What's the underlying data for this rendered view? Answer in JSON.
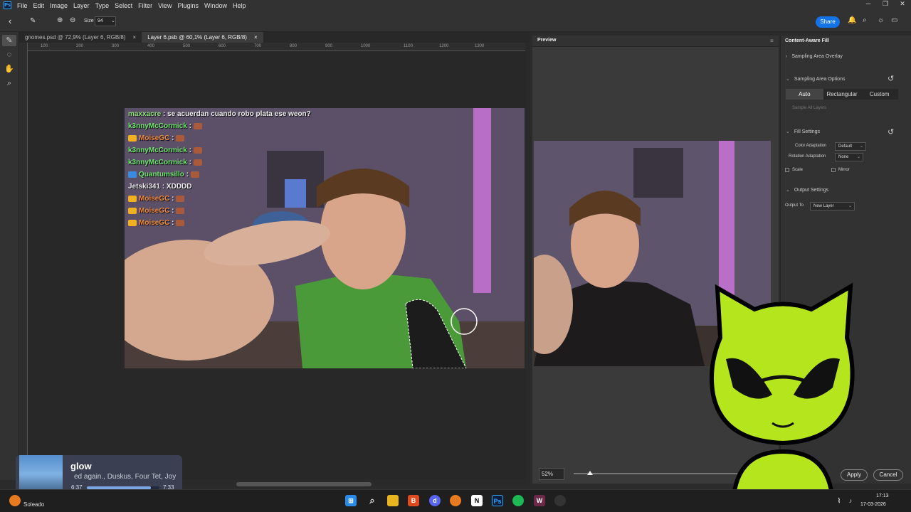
{
  "menu": {
    "logo": "Ps",
    "items": [
      "File",
      "Edit",
      "Image",
      "Layer",
      "Type",
      "Select",
      "Filter",
      "View",
      "Plugins",
      "Window",
      "Help"
    ],
    "window_controls": [
      "─",
      "❐",
      "✕"
    ]
  },
  "options_bar": {
    "size_label": "Size",
    "size_value": "94",
    "share_label": "Share"
  },
  "tabs": [
    {
      "label": "gnomes.psd @ 72,9% (Layer 6, RGB/8)",
      "close": "×"
    },
    {
      "label": "Layer 6.psb @ 60,1% (Layer 6, RGB/8)",
      "close": "×"
    }
  ],
  "ruler": {
    "ticks": [
      "100",
      "200",
      "300",
      "400",
      "500",
      "600",
      "700",
      "800",
      "900",
      "1000",
      "1100",
      "1200",
      "1300"
    ]
  },
  "chat": [
    {
      "user": "maxxacre",
      "msg": ": se acuerdan cuando robo plata ese weon?",
      "color": "#8ee07a",
      "emote": false,
      "badge": false
    },
    {
      "user": "k3nnyMcCormick",
      "msg": ":",
      "color": "#6ee86e",
      "emote": true,
      "badge": false
    },
    {
      "user": "MoiseGC",
      "msg": ":",
      "color": "#f08a3a",
      "emote": true,
      "badge": true
    },
    {
      "user": "k3nnyMcCormick",
      "msg": ":",
      "color": "#6ee86e",
      "emote": true,
      "badge": false
    },
    {
      "user": "k3nnyMcCormick",
      "msg": ":",
      "color": "#6ee86e",
      "emote": true,
      "badge": false
    },
    {
      "user": "Quantumsillo",
      "msg": ":",
      "color": "#6ee86e",
      "emote": true,
      "badge": true
    },
    {
      "user": "Jetski341",
      "msg": ": XDDDD",
      "color": "#e8e8e8",
      "emote": false,
      "badge": false
    },
    {
      "user": "MoiseGC",
      "msg": ":",
      "color": "#f08a3a",
      "emote": true,
      "badge": true
    },
    {
      "user": "MoiseGC",
      "msg": ":",
      "color": "#f08a3a",
      "emote": true,
      "badge": true
    },
    {
      "user": "MoiseGC",
      "msg": ":",
      "color": "#f08a3a",
      "emote": true,
      "badge": true
    }
  ],
  "preview": {
    "title": "Preview",
    "zoom": "52%"
  },
  "caf": {
    "title": "Content-Aware Fill",
    "sampling_overlay": "Sampling Area Overlay",
    "sampling_options": "Sampling Area Options",
    "seg": [
      "Auto",
      "Rectangular",
      "Custom"
    ],
    "sample_all_layers": "Sample All Layers",
    "fill_settings": "Fill Settings",
    "color_adaptation_label": "Color Adaptation",
    "color_adaptation_value": "Default",
    "rotation_adaptation_label": "Rotation Adaptation",
    "rotation_adaptation_value": "None",
    "scale_label": "Scale",
    "mirror_label": "Mirror",
    "output_settings": "Output Settings",
    "output_to_label": "Output To",
    "output_to_value": "New Layer",
    "apply_label": "Apply",
    "cancel_label": "Cancel"
  },
  "media": {
    "title": "glow",
    "artist": "ed again., Duskus, Four Tet, Joy",
    "elapsed": "6:37",
    "duration": "7:33",
    "progress": 0.88
  },
  "taskbar": {
    "weather": "Soleado",
    "time": "17:13",
    "date": "17-03-2026"
  },
  "colors": {
    "accent": "#1473e6",
    "green_overlay": "#4b9a3a",
    "mascot": "#b5e61d"
  }
}
